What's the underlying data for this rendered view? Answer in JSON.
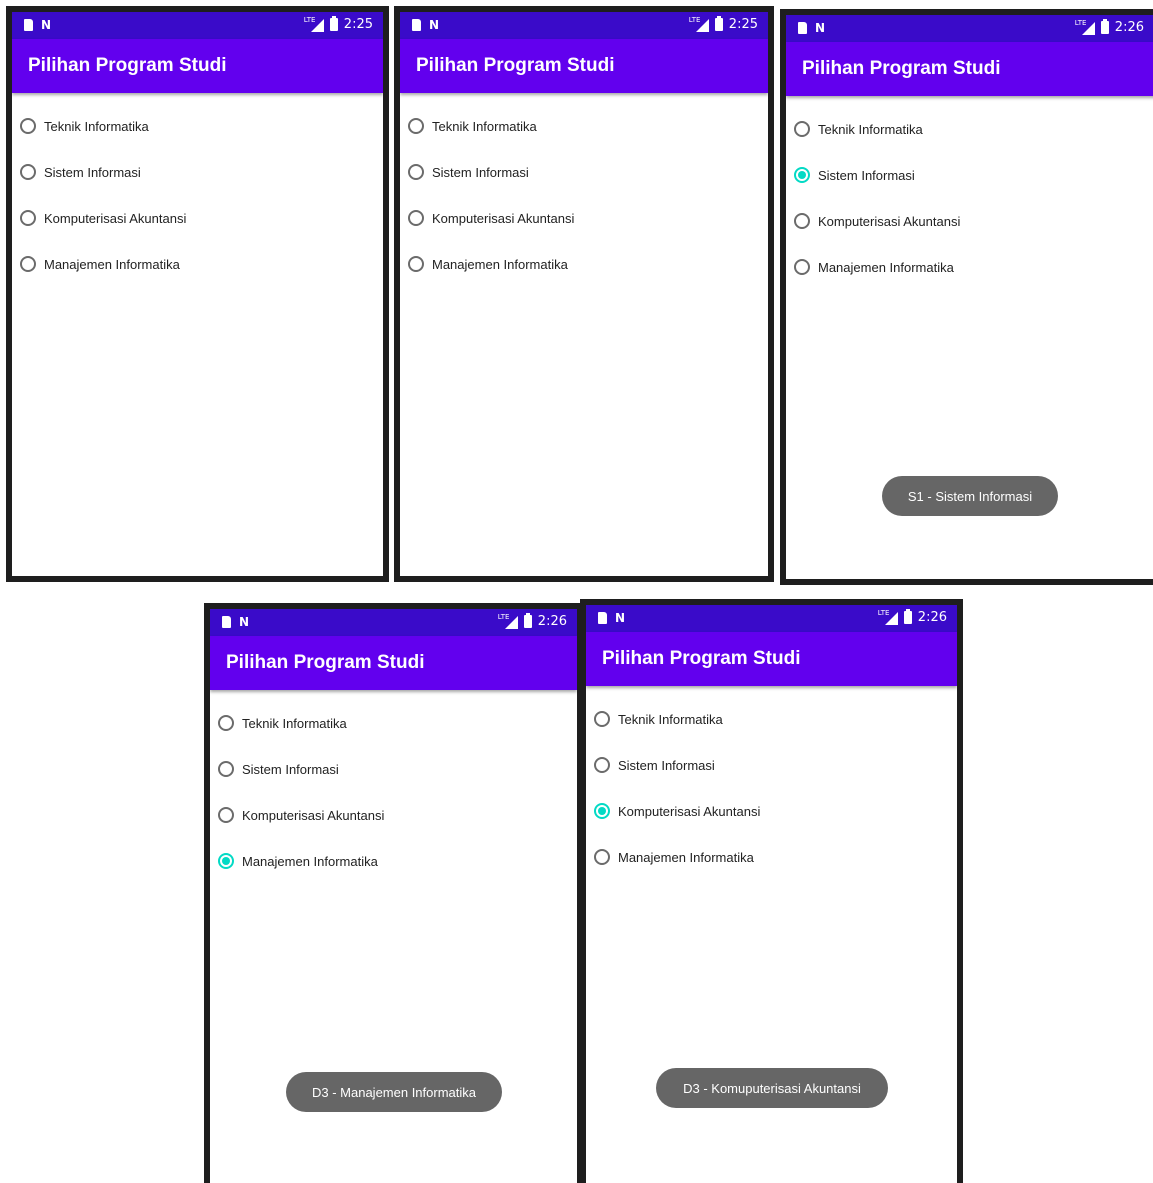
{
  "screens": [
    {
      "time": "2:25",
      "network": "LTE",
      "title": "Pilihan Program Studi",
      "options": [
        "Teknik Informatika",
        "Sistem Informasi",
        "Komputerisasi Akuntansi",
        "Manajemen Informatika"
      ],
      "selected_index": null,
      "toast": ""
    },
    {
      "time": "2:25",
      "network": "LTE",
      "title": "Pilihan Program Studi",
      "options": [
        "Teknik Informatika",
        "Sistem Informasi",
        "Komputerisasi Akuntansi",
        "Manajemen Informatika"
      ],
      "selected_index": null,
      "toast": ""
    },
    {
      "time": "2:26",
      "network": "LTE",
      "title": "Pilihan Program Studi",
      "options": [
        "Teknik Informatika",
        "Sistem Informasi",
        "Komputerisasi Akuntansi",
        "Manajemen Informatika"
      ],
      "selected_index": 1,
      "toast": "S1 - Sistem Informasi"
    },
    {
      "time": "2:26",
      "network": "LTE",
      "title": "Pilihan Program Studi",
      "options": [
        "Teknik Informatika",
        "Sistem Informasi",
        "Komputerisasi Akuntansi",
        "Manajemen Informatika"
      ],
      "selected_index": 3,
      "toast": "D3 - Manajemen Informatika"
    },
    {
      "time": "2:26",
      "network": "LTE",
      "title": "Pilihan Program Studi",
      "options": [
        "Teknik Informatika",
        "Sistem Informasi",
        "Komputerisasi Akuntansi",
        "Manajemen Informatika"
      ],
      "selected_index": 2,
      "toast": "D3 - Komuputerisasi Akuntansi"
    }
  ],
  "colors": {
    "status_bar": "#3a0bc9",
    "app_bar": "#6200ee",
    "radio_checked": "#03dac5",
    "radio_unchecked": "#6b6b6b",
    "toast_bg": "#666666"
  }
}
